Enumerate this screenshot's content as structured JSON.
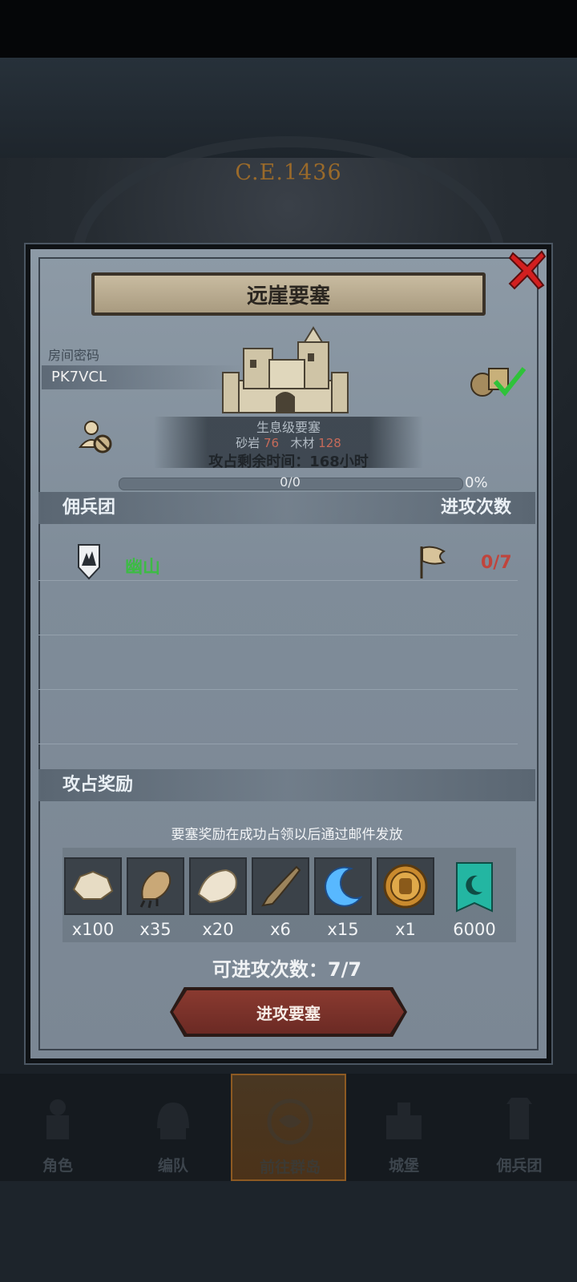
{
  "background": {
    "era_label": "C.E.1436"
  },
  "dialog": {
    "title": "远崖要塞",
    "room_code_label": "房间密码",
    "room_code": "PK7VCL",
    "fortress_level": "生息级要塞",
    "resource_1": {
      "name": "砂岩",
      "value": "76"
    },
    "resource_2": {
      "name": "木材",
      "value": "128"
    },
    "occupy_text": "攻占剩余时间：168小时",
    "progress_text": "0/0",
    "progress_percent_text": "0%",
    "progress_value": 0,
    "mercenary_header": "佣兵团",
    "attack_count_header": "进攻次数",
    "mercenaries": [
      {
        "name": "幽山",
        "attacks": "0/7"
      }
    ],
    "reward_header": "攻占奖励",
    "reward_note": "要塞奖励在成功占领以后通过邮件发放",
    "rewards": [
      {
        "icon": "hide-icon",
        "qty": "x100"
      },
      {
        "icon": "claw-icon",
        "qty": "x35"
      },
      {
        "icon": "fur-icon",
        "qty": "x20"
      },
      {
        "icon": "horn-icon",
        "qty": "x6"
      },
      {
        "icon": "crescent-moon-icon",
        "qty": "x15"
      },
      {
        "icon": "knight-medal-icon",
        "qty": "x1"
      },
      {
        "icon": "banner-icon",
        "qty": "6000"
      }
    ],
    "attempts_text": "可进攻次数：7/7",
    "attack_button": "进攻要塞"
  },
  "nav": [
    {
      "label": "角色",
      "icon": "knight-icon"
    },
    {
      "label": "编队",
      "icon": "helmet-icon"
    },
    {
      "label": "前往群岛",
      "icon": "compass-map-icon",
      "active": true
    },
    {
      "label": "城堡",
      "icon": "castle-icon"
    },
    {
      "label": "佣兵团",
      "icon": "tower-icon"
    }
  ],
  "colors": {
    "panel": "#8d9aa6",
    "merc_name": "#3dbb45",
    "attack_count": "#c0443c",
    "button": "#8a3a30",
    "close": "#d21f1f"
  }
}
